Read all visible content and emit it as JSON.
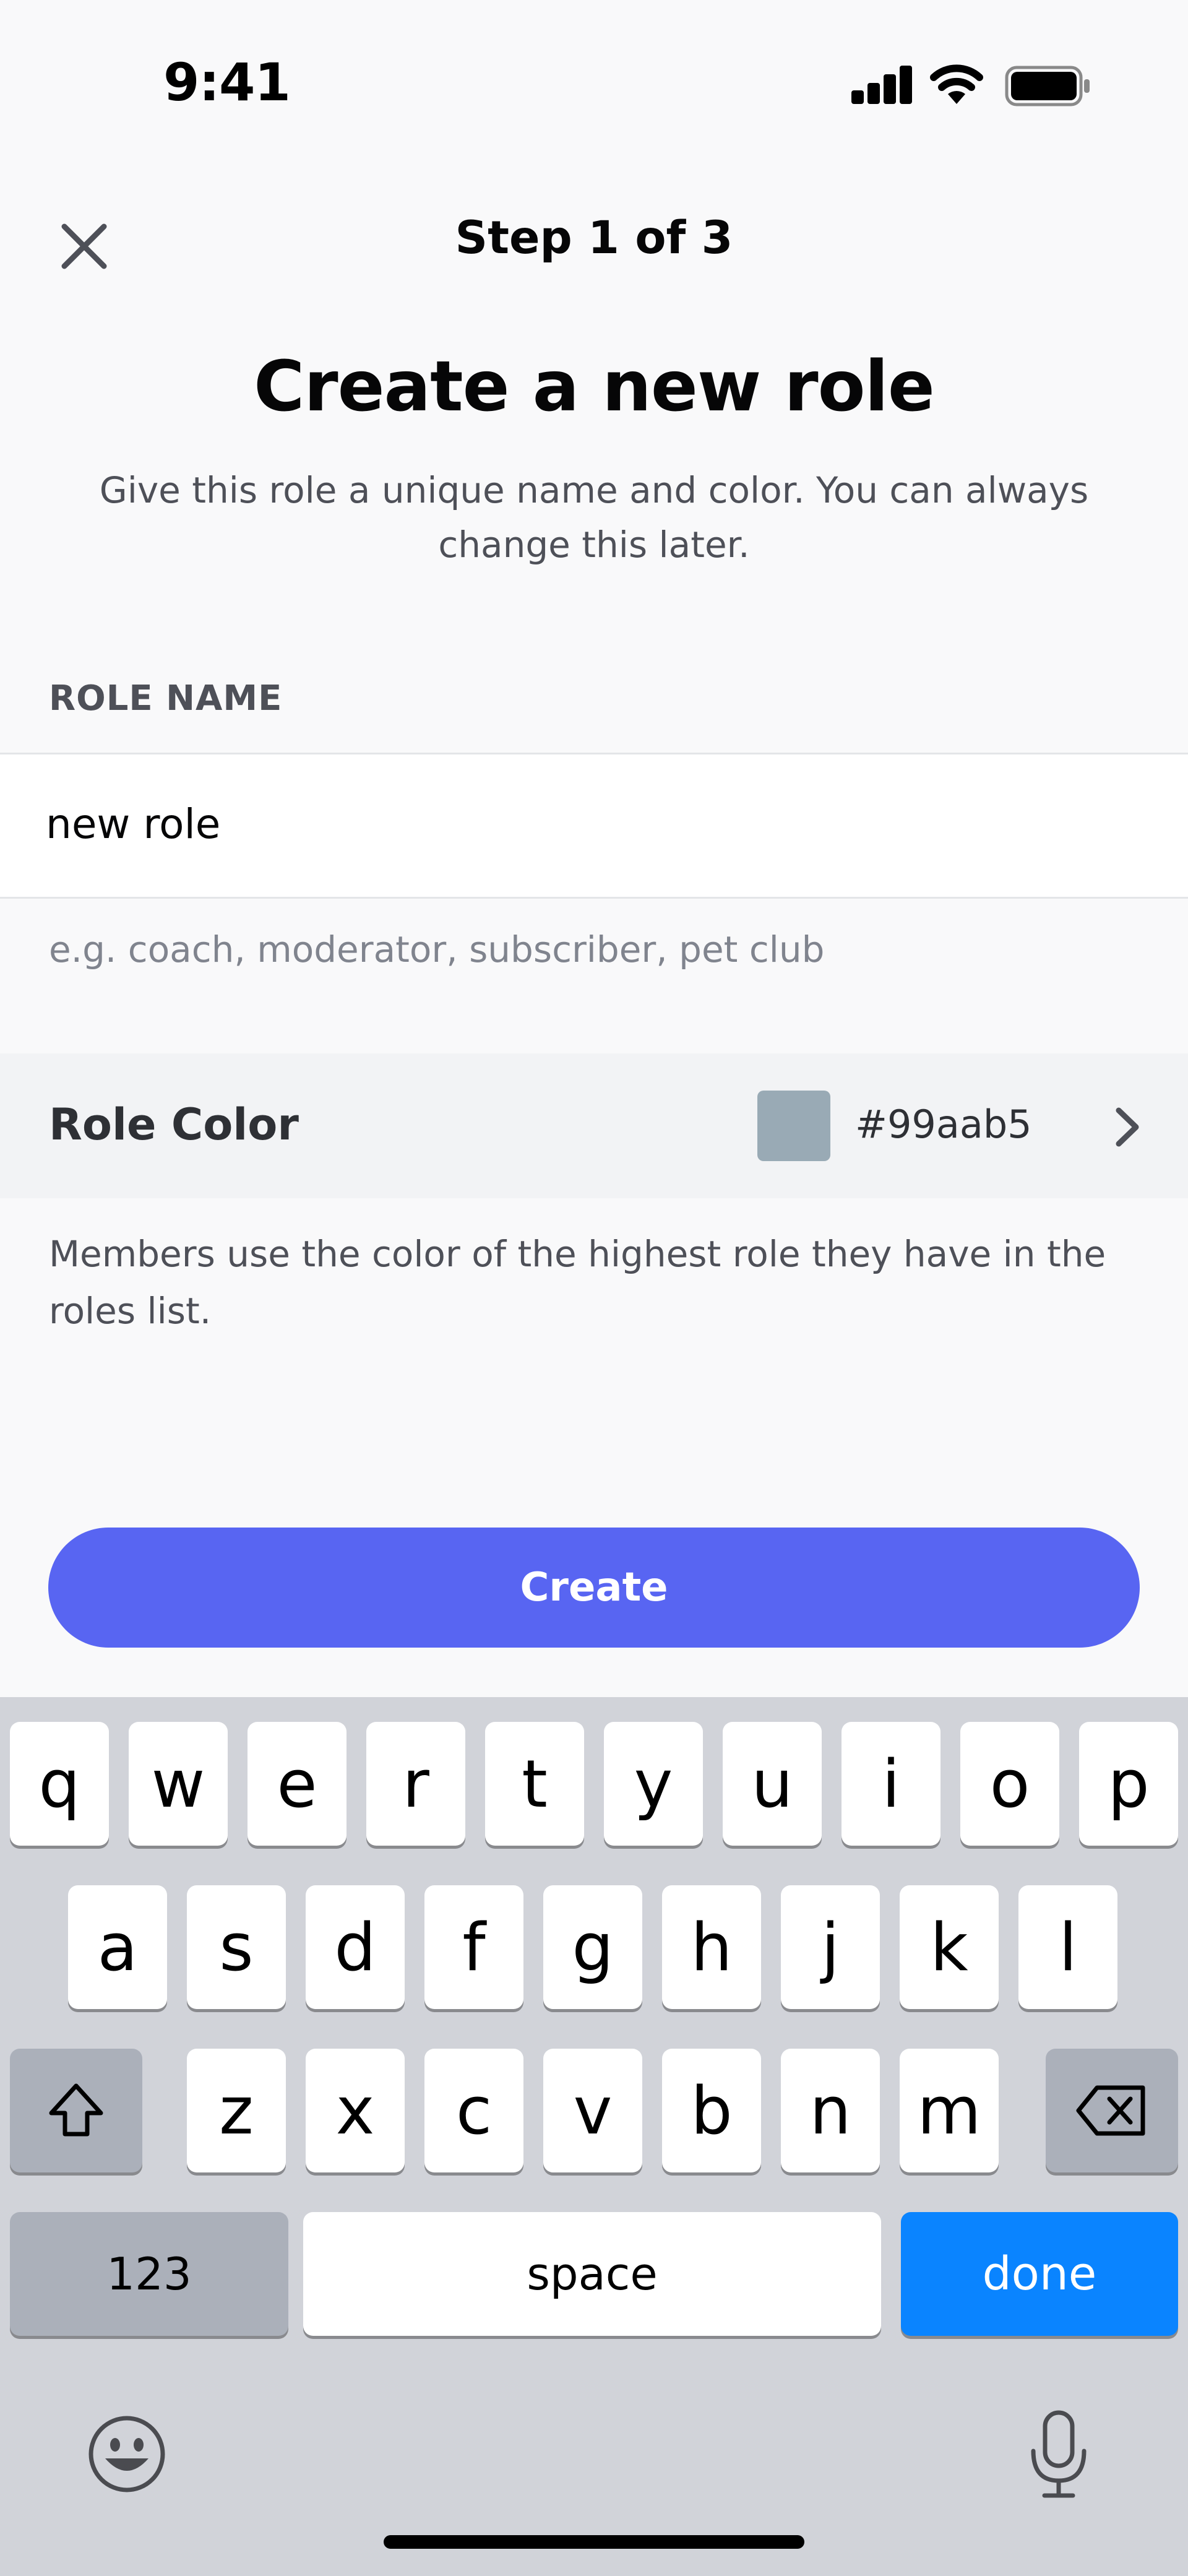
{
  "status_bar": {
    "time": "9:41"
  },
  "header": {
    "step": "Step 1 of 3",
    "close_icon": "close-icon"
  },
  "title": "Create a new role",
  "subtitle": "Give this role a unique name and color. You can always change this later.",
  "role_name": {
    "label": "ROLE NAME",
    "value": "new role",
    "helper": "e.g. coach, moderator, subscriber, pet club"
  },
  "role_color": {
    "label": "Role Color",
    "swatch_color": "#99aab5",
    "hex": "#99aab5"
  },
  "color_description": "Members use the color of the highest role they have in the roles list.",
  "create_button": {
    "label": "Create",
    "color": "#5865f2"
  },
  "keyboard": {
    "row1": [
      "q",
      "w",
      "e",
      "r",
      "t",
      "y",
      "u",
      "i",
      "o",
      "p"
    ],
    "row2": [
      "a",
      "s",
      "d",
      "f",
      "g",
      "h",
      "j",
      "k",
      "l"
    ],
    "row3": [
      "z",
      "x",
      "c",
      "v",
      "b",
      "n",
      "m"
    ],
    "numbers_key": "123",
    "space_key": "space",
    "done_key": "done",
    "done_color": "#0a84ff"
  }
}
